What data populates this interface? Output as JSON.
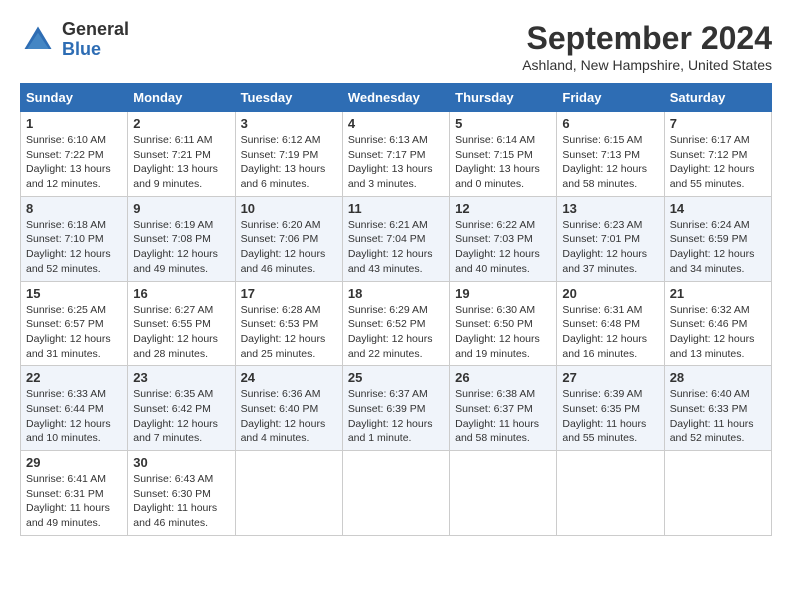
{
  "header": {
    "logo_line1": "General",
    "logo_line2": "Blue",
    "month": "September 2024",
    "location": "Ashland, New Hampshire, United States"
  },
  "weekdays": [
    "Sunday",
    "Monday",
    "Tuesday",
    "Wednesday",
    "Thursday",
    "Friday",
    "Saturday"
  ],
  "weeks": [
    [
      {
        "day": "1",
        "sunrise": "6:10 AM",
        "sunset": "7:22 PM",
        "daylight": "13 hours and 12 minutes."
      },
      {
        "day": "2",
        "sunrise": "6:11 AM",
        "sunset": "7:21 PM",
        "daylight": "13 hours and 9 minutes."
      },
      {
        "day": "3",
        "sunrise": "6:12 AM",
        "sunset": "7:19 PM",
        "daylight": "13 hours and 6 minutes."
      },
      {
        "day": "4",
        "sunrise": "6:13 AM",
        "sunset": "7:17 PM",
        "daylight": "13 hours and 3 minutes."
      },
      {
        "day": "5",
        "sunrise": "6:14 AM",
        "sunset": "7:15 PM",
        "daylight": "13 hours and 0 minutes."
      },
      {
        "day": "6",
        "sunrise": "6:15 AM",
        "sunset": "7:13 PM",
        "daylight": "12 hours and 58 minutes."
      },
      {
        "day": "7",
        "sunrise": "6:17 AM",
        "sunset": "7:12 PM",
        "daylight": "12 hours and 55 minutes."
      }
    ],
    [
      {
        "day": "8",
        "sunrise": "6:18 AM",
        "sunset": "7:10 PM",
        "daylight": "12 hours and 52 minutes."
      },
      {
        "day": "9",
        "sunrise": "6:19 AM",
        "sunset": "7:08 PM",
        "daylight": "12 hours and 49 minutes."
      },
      {
        "day": "10",
        "sunrise": "6:20 AM",
        "sunset": "7:06 PM",
        "daylight": "12 hours and 46 minutes."
      },
      {
        "day": "11",
        "sunrise": "6:21 AM",
        "sunset": "7:04 PM",
        "daylight": "12 hours and 43 minutes."
      },
      {
        "day": "12",
        "sunrise": "6:22 AM",
        "sunset": "7:03 PM",
        "daylight": "12 hours and 40 minutes."
      },
      {
        "day": "13",
        "sunrise": "6:23 AM",
        "sunset": "7:01 PM",
        "daylight": "12 hours and 37 minutes."
      },
      {
        "day": "14",
        "sunrise": "6:24 AM",
        "sunset": "6:59 PM",
        "daylight": "12 hours and 34 minutes."
      }
    ],
    [
      {
        "day": "15",
        "sunrise": "6:25 AM",
        "sunset": "6:57 PM",
        "daylight": "12 hours and 31 minutes."
      },
      {
        "day": "16",
        "sunrise": "6:27 AM",
        "sunset": "6:55 PM",
        "daylight": "12 hours and 28 minutes."
      },
      {
        "day": "17",
        "sunrise": "6:28 AM",
        "sunset": "6:53 PM",
        "daylight": "12 hours and 25 minutes."
      },
      {
        "day": "18",
        "sunrise": "6:29 AM",
        "sunset": "6:52 PM",
        "daylight": "12 hours and 22 minutes."
      },
      {
        "day": "19",
        "sunrise": "6:30 AM",
        "sunset": "6:50 PM",
        "daylight": "12 hours and 19 minutes."
      },
      {
        "day": "20",
        "sunrise": "6:31 AM",
        "sunset": "6:48 PM",
        "daylight": "12 hours and 16 minutes."
      },
      {
        "day": "21",
        "sunrise": "6:32 AM",
        "sunset": "6:46 PM",
        "daylight": "12 hours and 13 minutes."
      }
    ],
    [
      {
        "day": "22",
        "sunrise": "6:33 AM",
        "sunset": "6:44 PM",
        "daylight": "12 hours and 10 minutes."
      },
      {
        "day": "23",
        "sunrise": "6:35 AM",
        "sunset": "6:42 PM",
        "daylight": "12 hours and 7 minutes."
      },
      {
        "day": "24",
        "sunrise": "6:36 AM",
        "sunset": "6:40 PM",
        "daylight": "12 hours and 4 minutes."
      },
      {
        "day": "25",
        "sunrise": "6:37 AM",
        "sunset": "6:39 PM",
        "daylight": "12 hours and 1 minute."
      },
      {
        "day": "26",
        "sunrise": "6:38 AM",
        "sunset": "6:37 PM",
        "daylight": "11 hours and 58 minutes."
      },
      {
        "day": "27",
        "sunrise": "6:39 AM",
        "sunset": "6:35 PM",
        "daylight": "11 hours and 55 minutes."
      },
      {
        "day": "28",
        "sunrise": "6:40 AM",
        "sunset": "6:33 PM",
        "daylight": "11 hours and 52 minutes."
      }
    ],
    [
      {
        "day": "29",
        "sunrise": "6:41 AM",
        "sunset": "6:31 PM",
        "daylight": "11 hours and 49 minutes."
      },
      {
        "day": "30",
        "sunrise": "6:43 AM",
        "sunset": "6:30 PM",
        "daylight": "11 hours and 46 minutes."
      },
      null,
      null,
      null,
      null,
      null
    ]
  ]
}
